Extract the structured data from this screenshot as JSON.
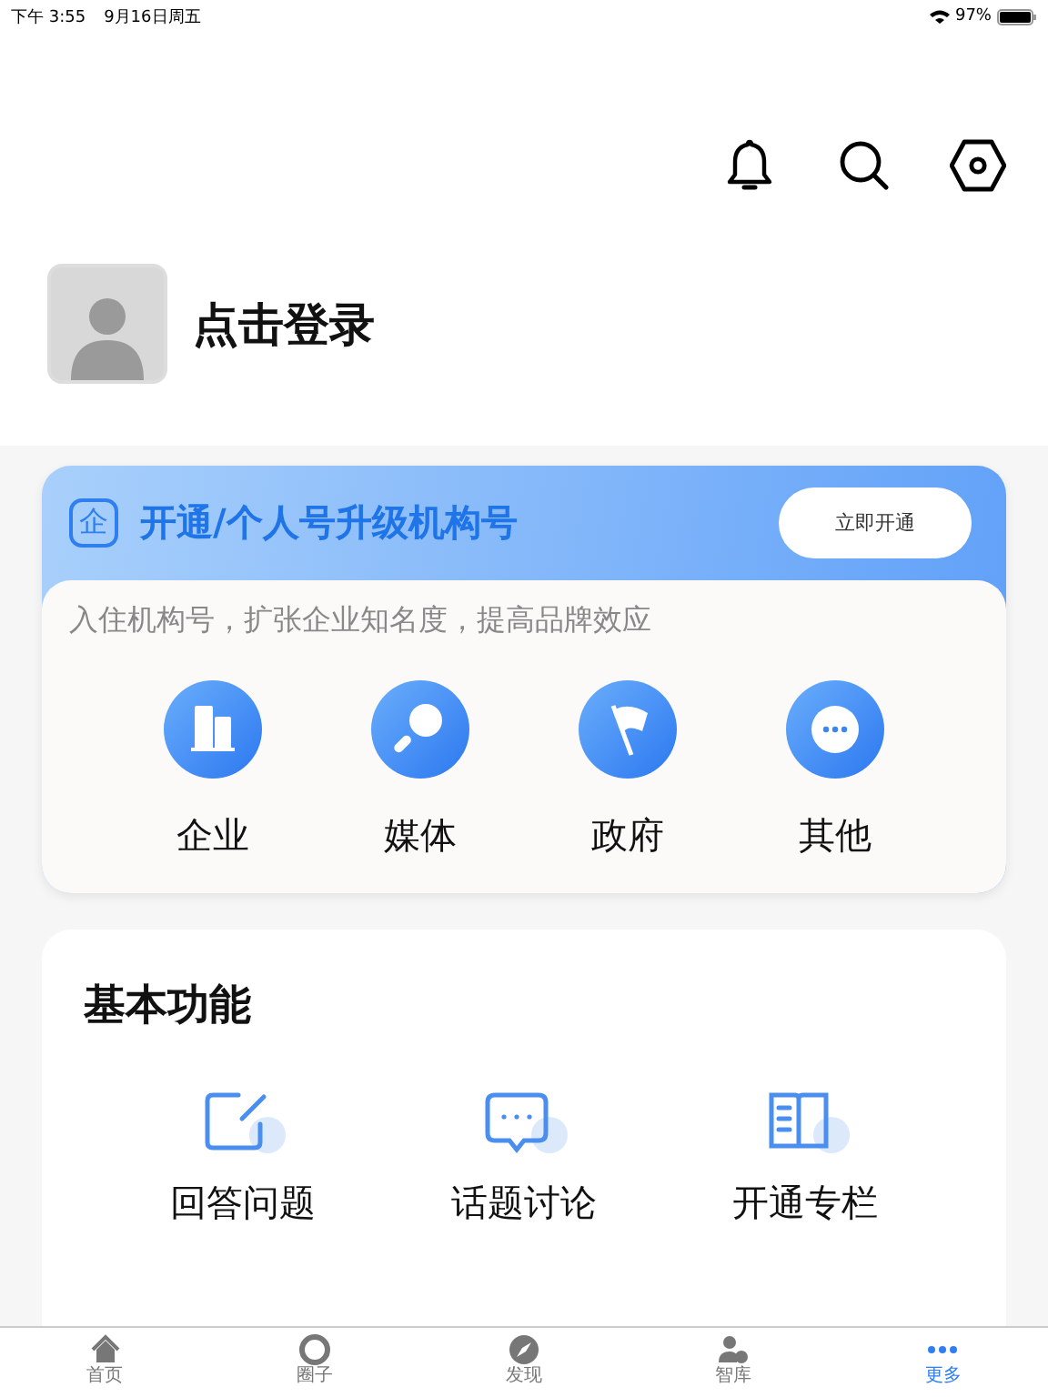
{
  "status_bar": {
    "time": "下午 3:55",
    "date": "9月16日周五",
    "battery": "97%"
  },
  "profile": {
    "login_label": "点击登录"
  },
  "org_card": {
    "badge": "企",
    "title": "开通/个人号升级机构号",
    "button": "立即开通",
    "subtitle": "入住机构号，扩张企业知名度，提高品牌效应",
    "types": [
      {
        "kind": "building",
        "label": "企业"
      },
      {
        "kind": "magnifier",
        "label": "媒体"
      },
      {
        "kind": "flag",
        "label": "政府"
      },
      {
        "kind": "more",
        "label": "其他"
      }
    ]
  },
  "features": {
    "title": "基本功能",
    "items": [
      {
        "kind": "edit",
        "label": "回答问题"
      },
      {
        "kind": "chat",
        "label": "话题讨论"
      },
      {
        "kind": "book",
        "label": "开通专栏"
      }
    ]
  },
  "tab_bar": [
    {
      "kind": "home",
      "label": "首页",
      "selected": false
    },
    {
      "kind": "aperture",
      "label": "圈子",
      "selected": false
    },
    {
      "kind": "compass",
      "label": "发现",
      "selected": false
    },
    {
      "kind": "person",
      "label": "智库",
      "selected": false
    },
    {
      "kind": "more",
      "label": "更多",
      "selected": true
    }
  ]
}
